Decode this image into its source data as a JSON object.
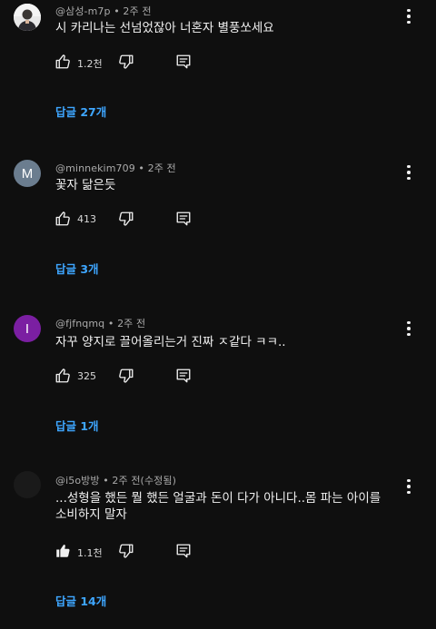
{
  "comments": [
    {
      "author": "@삼성-m7p",
      "time": "2주 전",
      "avatar_type": "photo",
      "avatar_letter": "",
      "avatar_color": "#d0d0d0",
      "lines": [
        "시 카리나는 선넘었잖아 너혼자 별풍쏘세요"
      ],
      "likes": "1.2천",
      "liked": false,
      "replies_label": "답글 27개"
    },
    {
      "author": "@minnekim709",
      "time": "2주 전",
      "avatar_type": "letter",
      "avatar_letter": "M",
      "avatar_color": "#6b7d8f",
      "lines": [
        "꽃자 닮은듯"
      ],
      "likes": "413",
      "liked": false,
      "replies_label": "답글 3개"
    },
    {
      "author": "@fjfnqmq",
      "time": "2주 전",
      "avatar_type": "letter",
      "avatar_letter": "I",
      "avatar_color": "#7b1fa2",
      "lines": [
        "자꾸 양지로 끌어올리는거 진짜 ㅈ같다 ㅋㅋ.."
      ],
      "likes": "325",
      "liked": false,
      "replies_label": "답글 1개"
    },
    {
      "author": "@i5o방방",
      "time": "2주 전(수정됨)",
      "avatar_type": "dark",
      "avatar_letter": "",
      "avatar_color": "#1a1a1a",
      "lines": [
        "...성형을 했든 뭘 했든 얼굴과 돈이 다가 아니다..몸 파는 아이를",
        "소비하지 말자"
      ],
      "likes": "1.1천",
      "liked": true,
      "replies_label": "답글 14개"
    }
  ],
  "colors": {
    "background": "#0f0f0f",
    "text": "#f1f1f1",
    "meta": "#aaaaaa",
    "link": "#3ea6ff"
  },
  "icons": {
    "like": "thumbs-up-icon",
    "dislike": "thumbs-down-icon",
    "reply": "comment-icon",
    "menu": "more-vert-icon"
  }
}
